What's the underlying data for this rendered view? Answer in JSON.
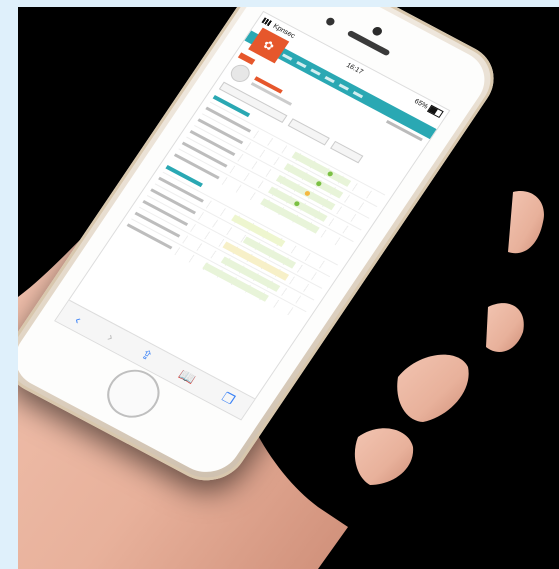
{
  "status_bar": {
    "carrier": "Kpnsec",
    "time": "16:17",
    "battery": "65%"
  },
  "browser_toolbar": {
    "back": "chevron-left-icon",
    "forward": "chevron-right-icon",
    "share": "share-icon",
    "bookmarks": "book-icon",
    "tabs": "tabs-icon"
  },
  "colors": {
    "brand": "#e6572c",
    "nav": "#2aa8b3",
    "background": "#dff0fb"
  }
}
